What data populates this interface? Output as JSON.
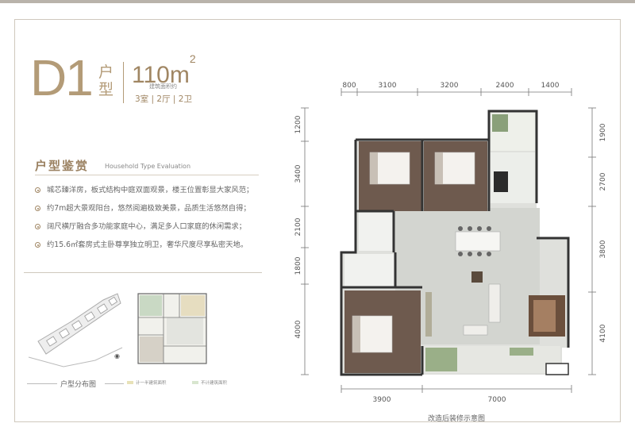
{
  "unit": {
    "code": "D1",
    "type_label": "户型",
    "area": "110m",
    "area_sup": "2",
    "area_caption": "建筑面积约",
    "rooms": "3室 | 2厅 | 2卫"
  },
  "appreciation": {
    "title": "户型鉴赏",
    "title_en": "Household Type Evaluation",
    "features": [
      "城芯臻洋房，板式结构中庭双面观景，楼王位置彰显大家风范；",
      "约7m超大景观阳台，悠然阅遍极致美景，品质生活悠然自得；",
      "阔尺横厅融合多功能家庭中心，满足多人口家庭的休闲需求；",
      "约15.6㎡套房式主卧尊享独立明卫，奢华尺度尽享私密天地。"
    ]
  },
  "distribution": {
    "label": "户型分布图",
    "legend": [
      "计一半建筑面积",
      "不计建筑面积"
    ]
  },
  "plan": {
    "top_dims": [
      "800",
      "3100",
      "3200",
      "2400",
      "1400"
    ],
    "bottom_dims": [
      "3900",
      "7000"
    ],
    "left_dims": [
      "1200",
      "3400",
      "2100",
      "1800",
      "4000"
    ],
    "right_dims": [
      "1900",
      "2700",
      "3800",
      "4100"
    ],
    "caption": "改造后装修示意图"
  },
  "colors": {
    "gold": "#b39b77",
    "wood": "#6e5a4e",
    "floor": "#d9dbd6",
    "wall": "#3a3a3a"
  }
}
